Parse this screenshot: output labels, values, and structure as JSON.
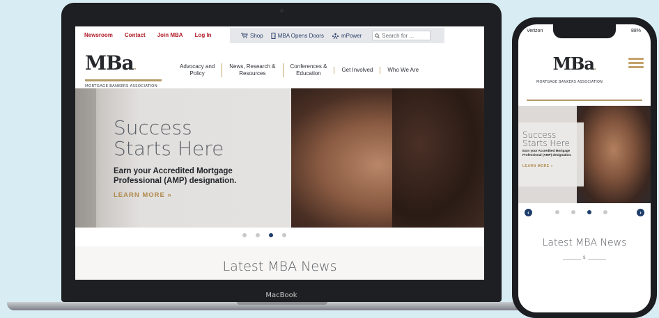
{
  "laptop": {
    "brand": "MacBook",
    "site": {
      "utility_links": [
        "Newsroom",
        "Contact",
        "Join MBA",
        "Log In"
      ],
      "utility_right": [
        {
          "icon": "cart-icon",
          "label": "Shop"
        },
        {
          "icon": "door-icon",
          "label": "MBA Opens Doors"
        },
        {
          "icon": "people-icon",
          "label": "mPower"
        }
      ],
      "search_placeholder": "Search for ...",
      "logo": {
        "word": "MBa",
        "dot": ".",
        "subtitle": "MORTGAGE BANKERS ASSOCIATION"
      },
      "nav": [
        "Advocacy and\nPolicy",
        "News, Research &\nResources",
        "Conferences &\nEducation",
        "Get Involved",
        "Who We Are"
      ],
      "hero": {
        "title_line1": "Success",
        "title_line2": "Starts Here",
        "sub_line1": "Earn your Accredited Mortgage",
        "sub_line2": "Professional (AMP) designation.",
        "cta": "LEARN MORE »"
      },
      "carousel": {
        "count": 4,
        "active": 3
      },
      "news_title": "Latest MBA News"
    }
  },
  "phone": {
    "status_carrier": "Verizon",
    "status_battery": "88%",
    "logo": {
      "word": "MBa",
      "dot": ".",
      "subtitle": "MORTGAGE BANKERS ASSOCIATION"
    },
    "hero": {
      "title_line1": "Success",
      "title_line2": "Starts Here",
      "sub": "Earn your Accredited Mortgage Professional (AMP) designation.",
      "cta": "LEARN MORE »"
    },
    "carousel": {
      "count": 4,
      "active": 3
    },
    "arrow_left": "‹",
    "arrow_right": "›",
    "news_title": "Latest MBA News",
    "divider_mark": "$"
  },
  "colors": {
    "accent_red": "#b01c28",
    "navy": "#1e3d6b",
    "gold": "#b49a6a"
  }
}
